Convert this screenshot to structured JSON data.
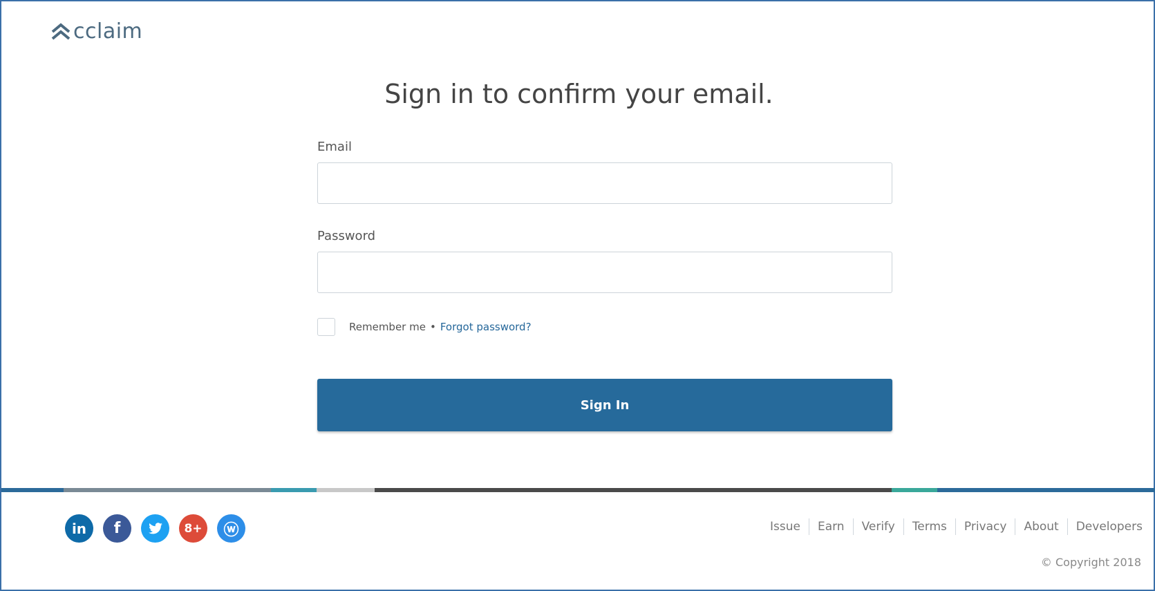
{
  "logo": {
    "text": "cclaim",
    "icon": "double-chevron-up-icon"
  },
  "page": {
    "title": "Sign in to confirm your email."
  },
  "form": {
    "email_label": "Email",
    "email_value": "",
    "password_label": "Password",
    "password_value": "",
    "remember_label": "Remember me",
    "separator": "•",
    "forgot_label": "Forgot password?",
    "submit_label": "Sign In"
  },
  "social": [
    {
      "name": "linkedin-icon",
      "glyph": "in",
      "color": "#0e6aa8"
    },
    {
      "name": "facebook-icon",
      "glyph": "f",
      "color": "#3b5998"
    },
    {
      "name": "twitter-icon",
      "glyph": "🐦",
      "color": "#1da1f2"
    },
    {
      "name": "google-plus-icon",
      "glyph": "8+",
      "color": "#dd4b39"
    },
    {
      "name": "weebly-icon",
      "glyph": "ⓦ",
      "color": "#2d8ee8"
    }
  ],
  "footer": {
    "links": [
      "Issue",
      "Earn",
      "Verify",
      "Terms",
      "Privacy",
      "About",
      "Developers"
    ],
    "copyright": "© Copyright 2018"
  },
  "colors": {
    "accent": "#266a9b",
    "link": "#25679a",
    "stripe": [
      "#2c6a9a",
      "#7a8a95",
      "#3a9bb0",
      "#c8c8c8",
      "#4a4a4a",
      "#3aa89a",
      "#2c6a9a"
    ]
  }
}
